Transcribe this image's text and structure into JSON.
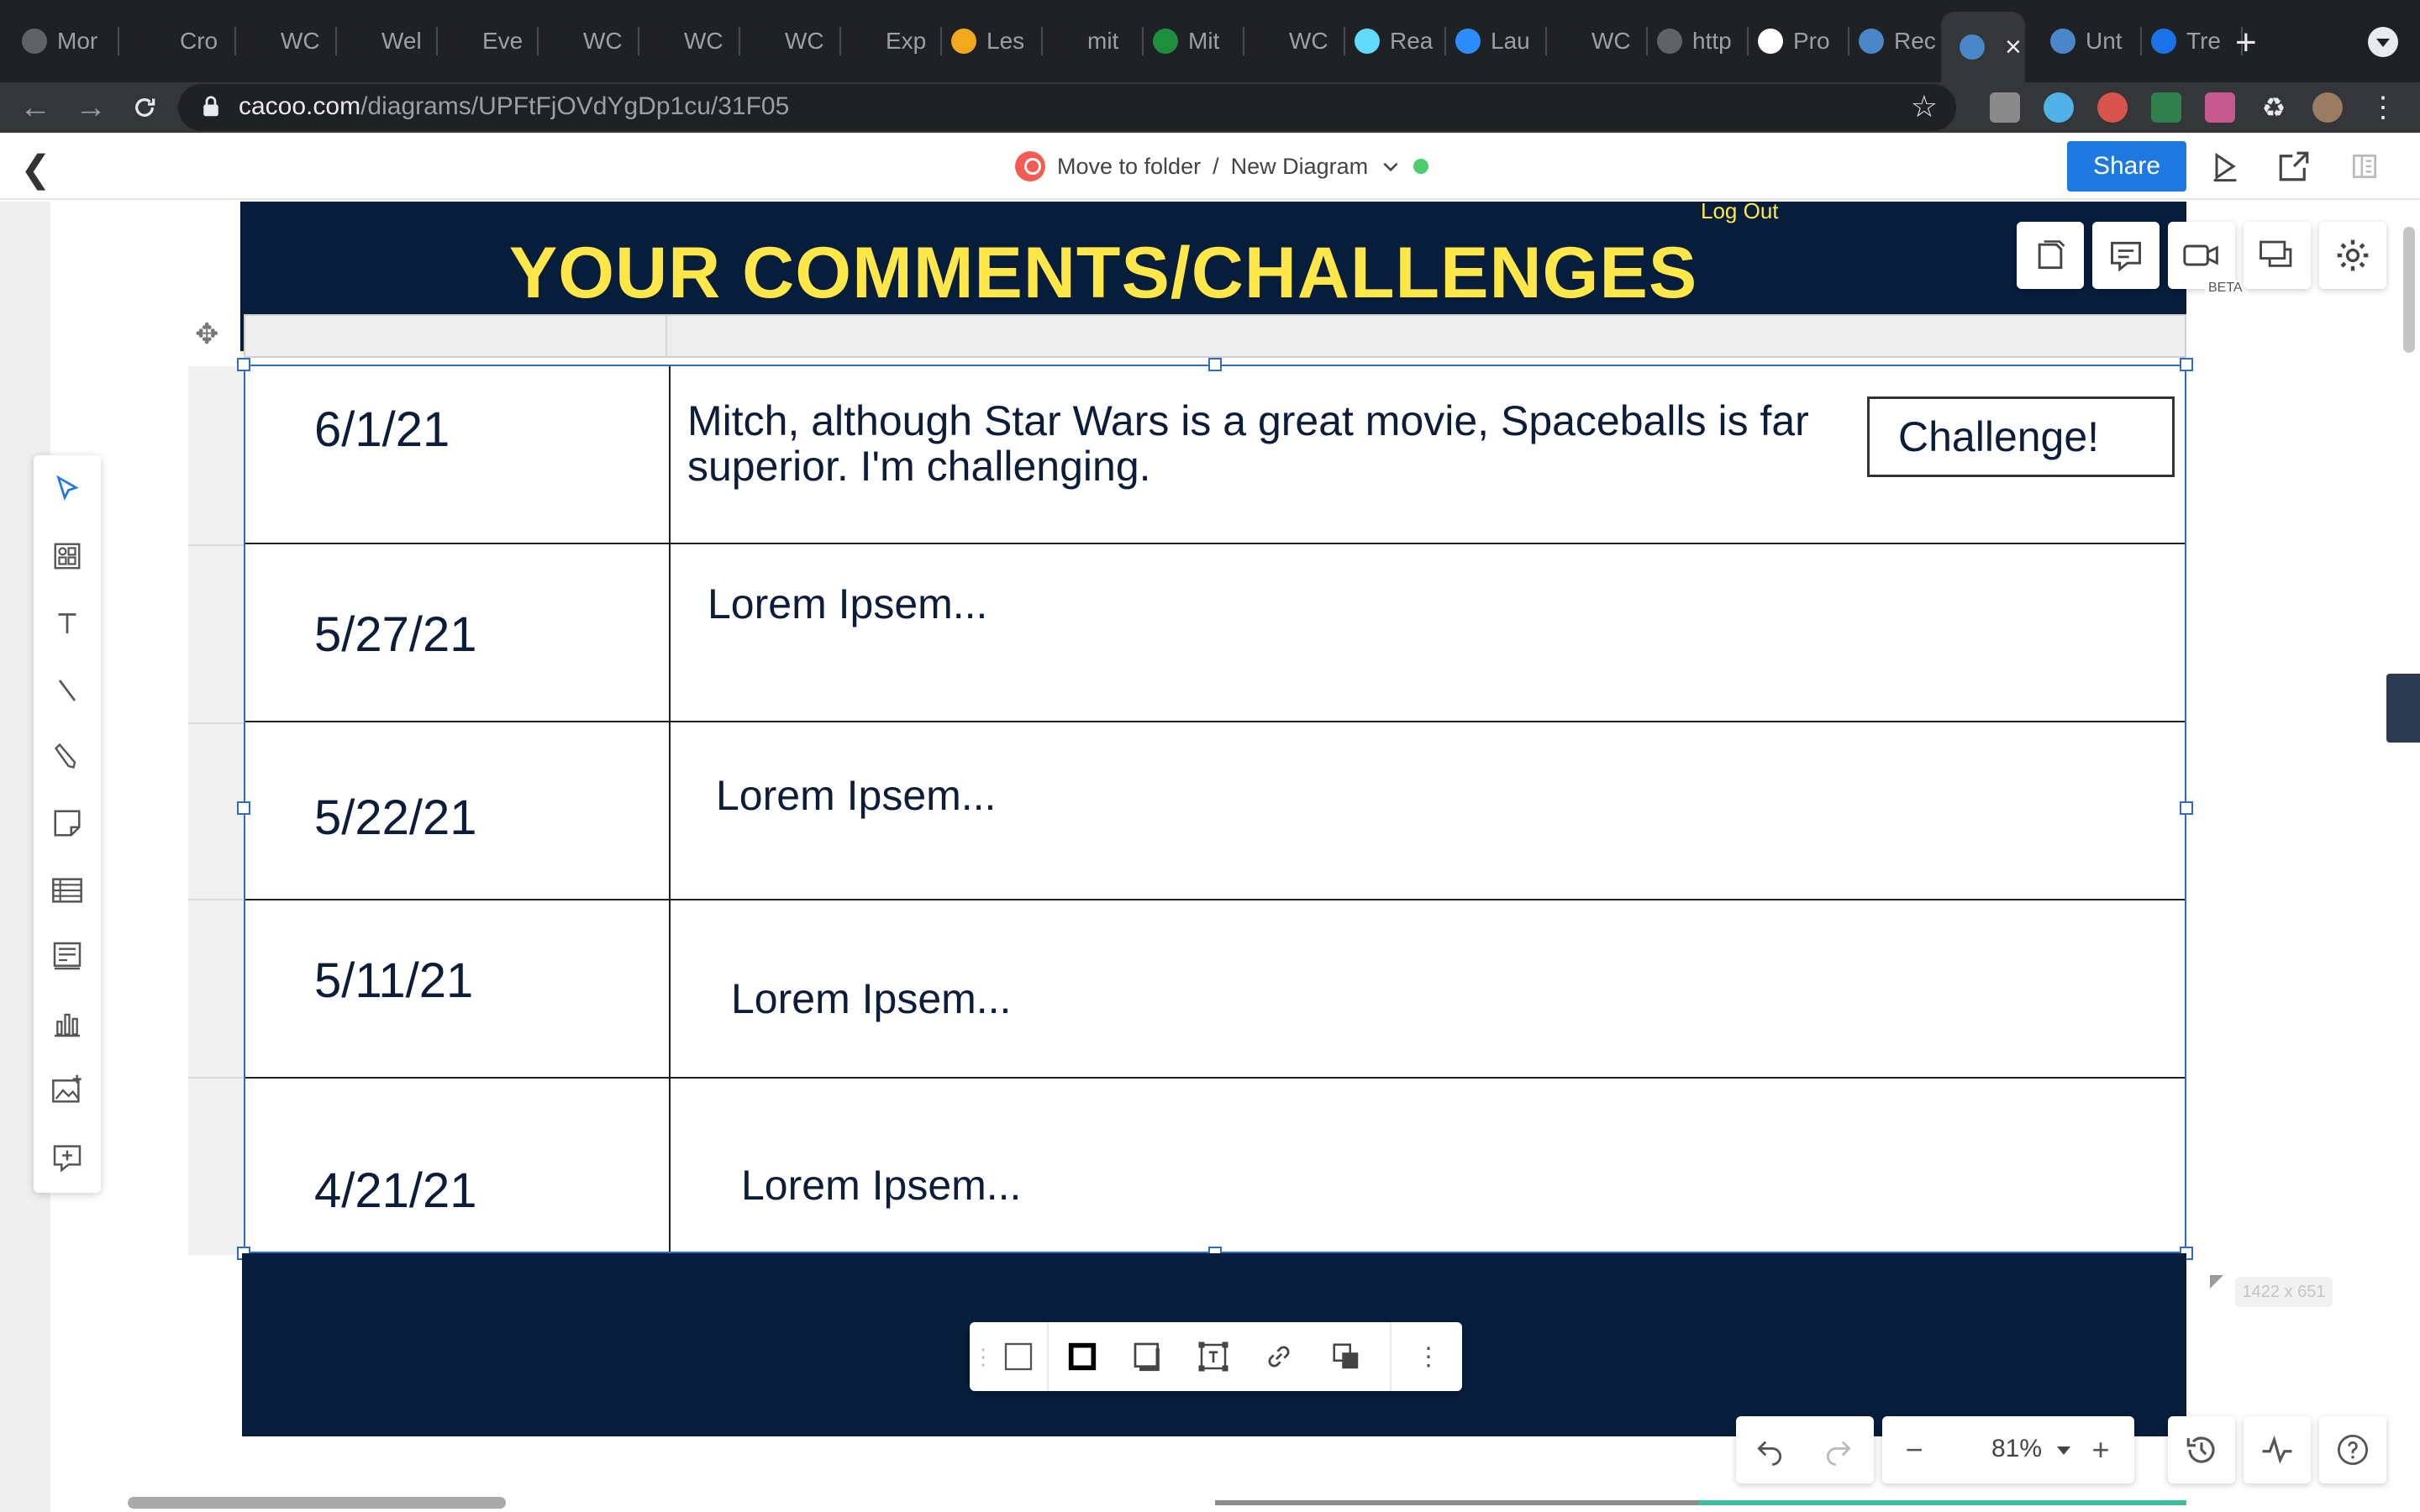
{
  "browser": {
    "tabs": [
      {
        "label": "Mor",
        "icon": "chrome-icon",
        "color": "#5f6368"
      },
      {
        "label": "Cro",
        "icon": "cap-icon",
        "color": "#202124"
      },
      {
        "label": "WC",
        "icon": "github-icon",
        "color": "#202124"
      },
      {
        "label": "Wel",
        "icon": "cap-icon",
        "color": "#202124"
      },
      {
        "label": "Eve",
        "icon": "cap-icon",
        "color": "#202124"
      },
      {
        "label": "WC",
        "icon": "github-icon",
        "color": "#202124"
      },
      {
        "label": "WC",
        "icon": "github-icon",
        "color": "#202124"
      },
      {
        "label": "WC",
        "icon": "github-icon",
        "color": "#202124"
      },
      {
        "label": "Exp",
        "icon": "cap-icon",
        "color": "#202124"
      },
      {
        "label": "Les",
        "icon": "lesson-icon",
        "color": "#f2a81d"
      },
      {
        "label": "mit",
        "icon": "github-icon",
        "color": "#202124"
      },
      {
        "label": "Mit",
        "icon": "sheets-icon",
        "color": "#1e8e3e"
      },
      {
        "label": "WC",
        "icon": "github-icon",
        "color": "#202124"
      },
      {
        "label": "Rea",
        "icon": "react-icon",
        "color": "#61dafb"
      },
      {
        "label": "Lau",
        "icon": "zoom-icon",
        "color": "#2d8cff"
      },
      {
        "label": "WC",
        "icon": "github-icon",
        "color": "#202124"
      },
      {
        "label": "http",
        "icon": "globe-icon",
        "color": "#5f6368"
      },
      {
        "label": "Pro",
        "icon": "hi-icon",
        "color": "#ffffff"
      },
      {
        "label": "Rec",
        "icon": "cacoo-icon",
        "color": "#4a86c8"
      },
      {
        "label": "",
        "icon": "cacoo-icon",
        "color": "#4a86c8",
        "active": true
      },
      {
        "label": "Unt",
        "icon": "cacoo-icon",
        "color": "#4a86c8"
      },
      {
        "label": "Tre",
        "icon": "browser-icon",
        "color": "#1a73e8"
      }
    ],
    "url_domain": "cacoo.com",
    "url_path": "/diagrams/UPFtFjOVdYgDp1cu/31F05"
  },
  "app": {
    "folder_label": "Move to folder",
    "separator": "/",
    "diagram_name": "New Diagram",
    "share_label": "Share",
    "beta_label": "BETA"
  },
  "diagram": {
    "title": "YOUR COMMENTS/CHALLENGES",
    "logout": "Log Out",
    "rows": [
      {
        "date": "6/1/21",
        "comment": "Mitch, although Star Wars is a great movie, Spaceballs is far superior.  I'm challenging.",
        "button": "Challenge!"
      },
      {
        "date": "5/27/21",
        "comment": "Lorem Ipsem..."
      },
      {
        "date": "5/22/21",
        "comment": "Lorem Ipsem..."
      },
      {
        "date": "5/11/21",
        "comment": "Lorem Ipsem..."
      },
      {
        "date": "4/21/21",
        "comment": "Lorem Ipsem..."
      }
    ],
    "size_hint": "1422 x 651"
  },
  "zoom": {
    "level": "81%"
  },
  "colors": {
    "navy": "#071d3c",
    "title_yellow": "#ffe74a",
    "selection_blue": "#2d6ec4",
    "share_blue": "#1d79e0"
  }
}
